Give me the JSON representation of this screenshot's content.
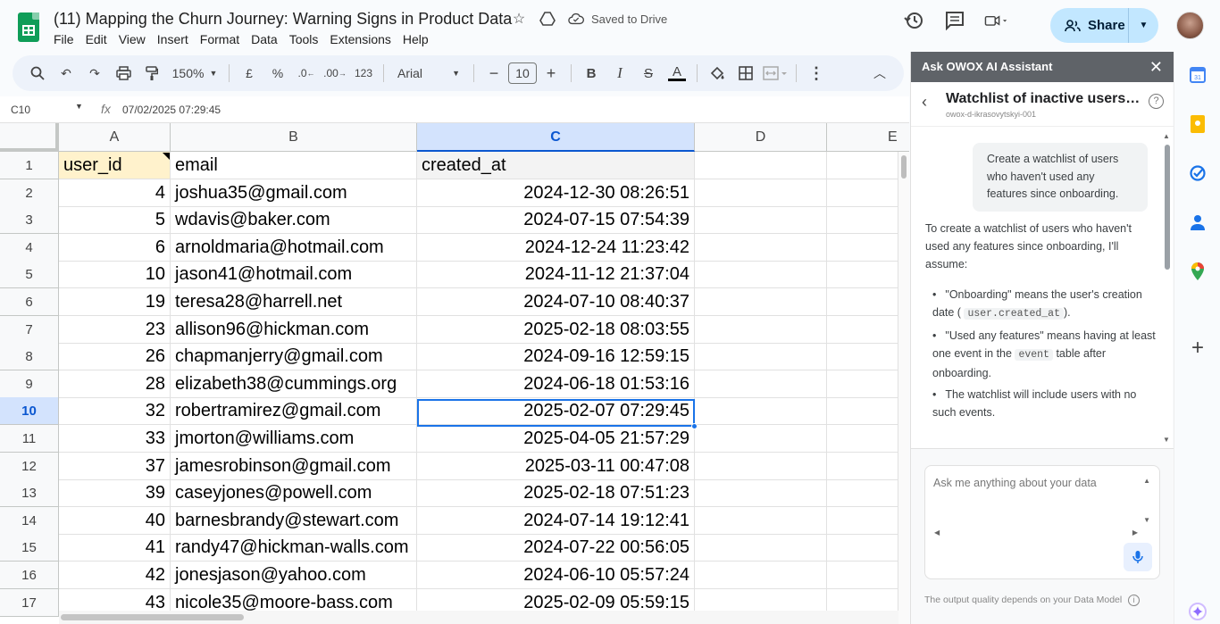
{
  "doc": {
    "title": "(11) Mapping the Churn Journey: Warning Signs in Product Data",
    "saved": "Saved to Drive"
  },
  "menu": [
    "File",
    "Edit",
    "View",
    "Insert",
    "Format",
    "Data",
    "Tools",
    "Extensions",
    "Help"
  ],
  "share": {
    "label": "Share"
  },
  "toolbar": {
    "zoom": "150%",
    "currency": "£",
    "percent": "%",
    "dec_decrease": ".0",
    "dec_increase": ".00",
    "number_format": "123",
    "font": "Arial",
    "font_size": "10"
  },
  "formula_bar": {
    "cell_ref": "C10",
    "fx": "fx",
    "value": "07/02/2025 07:29:45"
  },
  "sheet": {
    "columns": [
      "A",
      "B",
      "C",
      "D",
      "E"
    ],
    "selected_row": "10",
    "selected_col": "C",
    "header": [
      "user_id",
      "email",
      "created_at"
    ],
    "rows": [
      {
        "n": "1"
      },
      {
        "n": "2",
        "id": "4",
        "email": "joshua35@gmail.com",
        "created": "2024-12-30 08:26:51"
      },
      {
        "n": "3",
        "id": "5",
        "email": "wdavis@baker.com",
        "created": "2024-07-15 07:54:39"
      },
      {
        "n": "4",
        "id": "6",
        "email": "arnoldmaria@hotmail.com",
        "created": "2024-12-24 11:23:42"
      },
      {
        "n": "5",
        "id": "10",
        "email": "jason41@hotmail.com",
        "created": "2024-11-12 21:37:04"
      },
      {
        "n": "6",
        "id": "19",
        "email": "teresa28@harrell.net",
        "created": "2024-07-10 08:40:37"
      },
      {
        "n": "7",
        "id": "23",
        "email": "allison96@hickman.com",
        "created": "2025-02-18 08:03:55"
      },
      {
        "n": "8",
        "id": "26",
        "email": "chapmanjerry@gmail.com",
        "created": "2024-09-16 12:59:15"
      },
      {
        "n": "9",
        "id": "28",
        "email": "elizabeth38@cummings.org",
        "created": "2024-06-18 01:53:16"
      },
      {
        "n": "10",
        "id": "32",
        "email": "robertramirez@gmail.com",
        "created": "2025-02-07 07:29:45"
      },
      {
        "n": "11",
        "id": "33",
        "email": "jmorton@williams.com",
        "created": "2025-04-05 21:57:29"
      },
      {
        "n": "12",
        "id": "37",
        "email": "jamesrobinson@gmail.com",
        "created": "2025-03-11 00:47:08"
      },
      {
        "n": "13",
        "id": "39",
        "email": "caseyjones@powell.com",
        "created": "2025-02-18 07:51:23"
      },
      {
        "n": "14",
        "id": "40",
        "email": "barnesbrandy@stewart.com",
        "created": "2024-07-14 19:12:41"
      },
      {
        "n": "15",
        "id": "41",
        "email": "randy47@hickman-walls.com",
        "created": "2024-07-22 00:56:05"
      },
      {
        "n": "16",
        "id": "42",
        "email": "jonesjason@yahoo.com",
        "created": "2024-06-10 05:57:24"
      },
      {
        "n": "17",
        "id": "43",
        "email": "nicole35@moore-bass.com",
        "created": "2025-02-09 05:59:15"
      }
    ]
  },
  "panel": {
    "header": "Ask OWOX AI Assistant",
    "chat_title": "Watchlist of inactive users si...",
    "chat_sub": "owox-d-ikrasovytskyi-001",
    "user_msg": "Create a watchlist of users who haven't used any features since onboarding.",
    "ai_intro": "To create a watchlist of users who haven't used any features since onboarding, I'll assume:",
    "b1_pre": "\"Onboarding\" means the user's creation date (",
    "b1_code": "user.created_at",
    "b1_post": ").",
    "b2_pre": "\"Used any features\" means having at least one event in the",
    "b2_code": "event",
    "b2_post": "table after onboarding.",
    "b3": "The watchlist will include users with no such events.",
    "input_placeholder": "Ask me anything about your data",
    "disclaimer": "The output quality depends on your Data Model"
  },
  "colors": {
    "accent": "#1a73e8",
    "share_bg": "#c2e7ff",
    "sheets_green": "#0f9d58",
    "panel_header": "#5f6368"
  }
}
